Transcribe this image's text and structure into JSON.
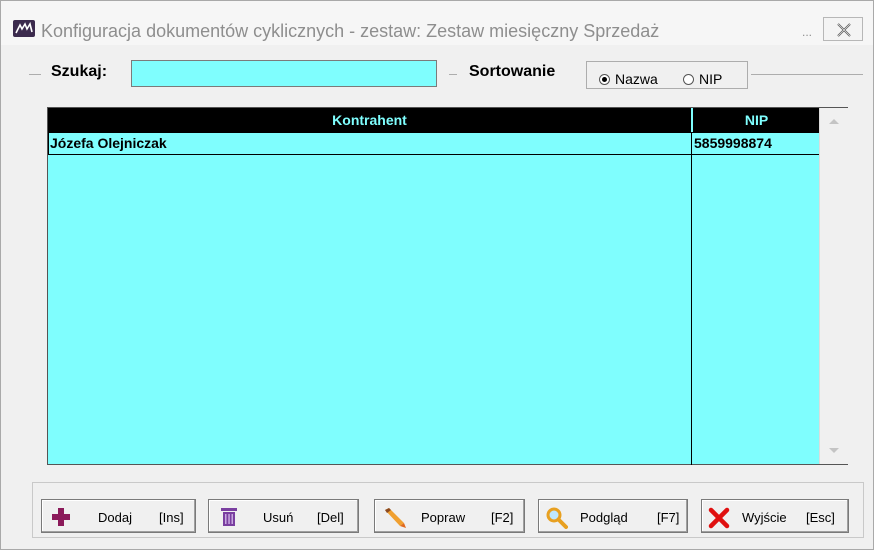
{
  "window": {
    "title": "Konfiguracja dokumentów cyklicznych - zestaw: Zestaw miesięczny Sprzedaż",
    "minimize_dots": "..."
  },
  "search": {
    "label": "Szukaj:",
    "value": "",
    "placeholder": ""
  },
  "sort": {
    "label": "Sortowanie",
    "options": [
      {
        "label": "Nazwa",
        "selected": true
      },
      {
        "label": "NIP",
        "selected": false
      }
    ]
  },
  "grid": {
    "columns": [
      "Kontrahent",
      "NIP"
    ],
    "rows": [
      {
        "kontrahent": "Józefa Olejniczak",
        "nip": "5859998874"
      }
    ]
  },
  "buttons": [
    {
      "label": "Dodaj",
      "key": "[Ins]",
      "icon": "plus-icon",
      "color": "#8b1a5a"
    },
    {
      "label": "Usuń",
      "key": "[Del]",
      "icon": "trash-icon",
      "color": "#7a3fa0"
    },
    {
      "label": "Popraw",
      "key": "[F2]",
      "icon": "pencil-icon",
      "color": "#e08020"
    },
    {
      "label": "Podgląd",
      "key": "[F7]",
      "icon": "magnifier-icon",
      "color": "#e8a020"
    },
    {
      "label": "Wyjście",
      "key": "[Esc]",
      "icon": "close-x-icon",
      "color": "#e01010"
    }
  ],
  "colors": {
    "grid_background": "#7ffefe",
    "header_background": "#000000",
    "header_text": "#7ffefe"
  }
}
